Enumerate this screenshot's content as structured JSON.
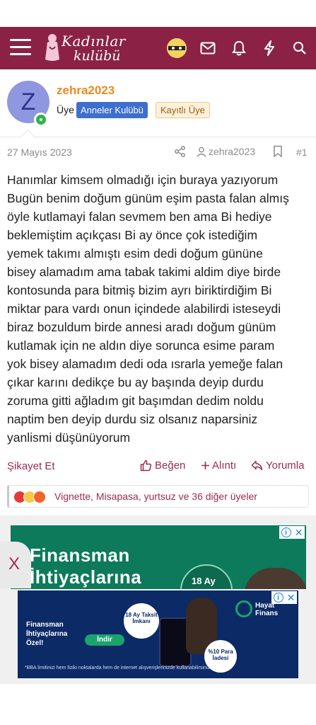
{
  "header": {
    "logo_line1": "Kadınlar",
    "logo_line2": "kulübü",
    "icons": [
      "menu-icon",
      "user-avatar-icon",
      "mail-icon",
      "bell-icon",
      "bolt-icon",
      "search-icon"
    ],
    "bar_color": "#8b2246"
  },
  "post": {
    "avatar_letter": "Z",
    "username": "zehra2023",
    "role": "Üye",
    "badge_primary": "Anneler Kulübü",
    "badge_secondary": "Kayıtlı Üye",
    "date": "27 Mayıs 2023",
    "author": "zehra2023",
    "number": "#1",
    "lines": [
      "Hanımlar kimsem olmadığı için buraya yazıyorum",
      "Bugün benim doğum günüm eşim pasta falan almış",
      "öyle kutlamayi falan sevmem ben ama Bi hediye",
      "beklemiştim açıkçası Bi ay önce çok istediğim",
      "yemek takımı almıştı esim dedi doğum gününe",
      "bisey alamadım ama tabak takimi aldim diye birde",
      "kontosunda para bitmiş bizim ayrı biriktirdiğim Bi",
      "miktar para vardı onun içindede alabilirdi isteseydi",
      "biraz bozuldum birde annesi aradı doğum günüm",
      "kutlamak için ne aldın diye sorunca esime param",
      "yok bisey alamadım dedi oda ısrarla yemeğe falan",
      "çıkar karını dedikçe bu ay başında deyip durdu",
      "zoruma gitti ağladım git başımdan dedim noldu",
      "naptim ben deyip durdu siz olsanız naparsiniz",
      "yanlismi düşünüyorum"
    ]
  },
  "actions": {
    "report": "Şikayet Et",
    "like": "Beğen",
    "quote": "Alıntı",
    "reply": "Yorumla"
  },
  "reactions": {
    "text": "Vignette, Misapasa, yurtsuz ve 36 diğer üyeler",
    "emojis": [
      "thumbs-down-icon",
      "sad-face-icon",
      "angry-face-icon"
    ]
  },
  "ads": {
    "close_label": "X",
    "ad1_line1": "Finansman",
    "ad1_line2": "İhtiyaçlarına",
    "ad1_circle": "18 Ay",
    "ad2_headline": "Finansman İhtiyaçlarına Özel!",
    "ad2_button": "İndir",
    "ad2_circle1": "18 Ay Taksit İmkanı",
    "ad2_circle2": "%10 Para İadesi",
    "ad2_brand": "Hayat Finans",
    "ad2_footer": "*BBA limitinizi hem fiziki noktalarda hem de internet alışverişlerinizde kullanabilirsiniz."
  }
}
